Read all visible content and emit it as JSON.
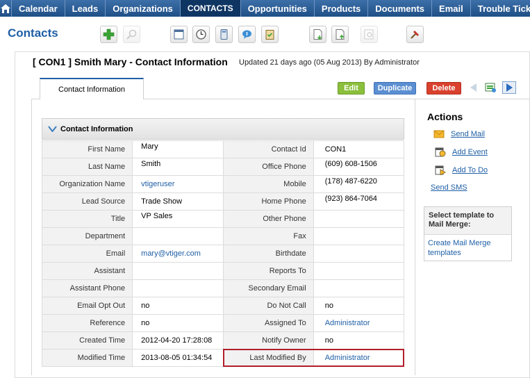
{
  "nav": {
    "tabs": [
      "Calendar",
      "Leads",
      "Organizations",
      "CONTACTS",
      "Opportunities",
      "Products",
      "Documents",
      "Email",
      "Trouble Tickets"
    ],
    "active": "CONTACTS"
  },
  "module_title": "Contacts",
  "record": {
    "title": "[ CON1 ]  Smith Mary - Contact Information",
    "updated": "Updated 21 days ago (05 Aug 2013) By Administrator"
  },
  "tab_label": "Contact Information",
  "buttons": {
    "edit": "Edit",
    "duplicate": "Duplicate",
    "delete": "Delete"
  },
  "section": {
    "title": "Contact Information"
  },
  "fields": [
    [
      "First Name",
      "Mary",
      "Contact Id",
      "CON1"
    ],
    [
      "Last Name",
      "Smith",
      "Office Phone",
      "(609) 608-1506"
    ],
    [
      "Organization Name",
      "vtigeruser",
      "Mobile",
      "(178) 487-6220"
    ],
    [
      "Lead Source",
      "Trade Show",
      "Home Phone",
      "(923) 864-7064"
    ],
    [
      "Title",
      "VP Sales",
      "Other Phone",
      ""
    ],
    [
      "Department",
      "",
      "Fax",
      ""
    ],
    [
      "Email",
      "mary@vtiger.com",
      "Birthdate",
      ""
    ],
    [
      "Assistant",
      "",
      "Reports To",
      ""
    ],
    [
      "Assistant Phone",
      "",
      "Secondary Email",
      ""
    ],
    [
      "Email Opt Out",
      "no",
      "Do Not Call",
      "no"
    ],
    [
      "Reference",
      "no",
      "Assigned To",
      "Administrator"
    ],
    [
      "Created Time",
      "2012-04-20 17:28:08",
      "Notify Owner",
      "no"
    ],
    [
      "Modified Time",
      "2013-08-05 01:34:54",
      "Last Modified By",
      "Administrator"
    ]
  ],
  "actions": {
    "title": "Actions",
    "send_mail": "Send Mail",
    "add_event": "Add Event",
    "add_todo": "Add To Do",
    "send_sms": "Send SMS"
  },
  "mail_merge": {
    "heading": "Select template to Mail Merge:",
    "link": "Create Mail Merge templates"
  }
}
